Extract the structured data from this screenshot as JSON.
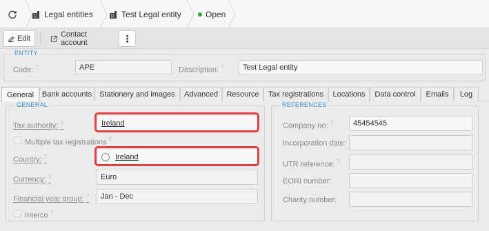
{
  "breadcrumb": {
    "items": [
      "Legal entities",
      "Test Legal entity",
      "Open"
    ]
  },
  "toolbar": {
    "edit_label": "Edit",
    "contact_label": "Contact account",
    "more_label": "⋮"
  },
  "entity": {
    "legend": "ENTITY",
    "code_label": "Code:",
    "code_value": "APE",
    "description_label": "Description:",
    "description_value": "Test Legal entity"
  },
  "tabs": [
    "General",
    "Bank accounts",
    "Stationery and images",
    "Advanced",
    "Resource",
    "Tax registrations",
    "Locations",
    "Data control",
    "Emails",
    "Log"
  ],
  "general": {
    "legend": "GENERAL",
    "tax_authority_label": "Tax authority:",
    "tax_authority_value": "Ireland",
    "multiple_tax_label": "Multiple tax registrations",
    "country_label": "Country:",
    "country_value": "Ireland",
    "currency_label": "Currency:",
    "currency_value": "Euro",
    "fy_group_label": "Financial year group:",
    "fy_group_value": "Jan - Dec",
    "interco_label": "Interco"
  },
  "references": {
    "legend": "REFERENCES",
    "company_no_label": "Company no:",
    "company_no_value": "45454545",
    "incorporation_label": "Incorporation date:",
    "utr_label": "UTR reference:",
    "eori_label": "EORI number:",
    "charity_label": "Charity number:"
  },
  "colors": {
    "accent": "#3a8fd0",
    "highlight": "#e04040",
    "status_open": "#33a532"
  }
}
